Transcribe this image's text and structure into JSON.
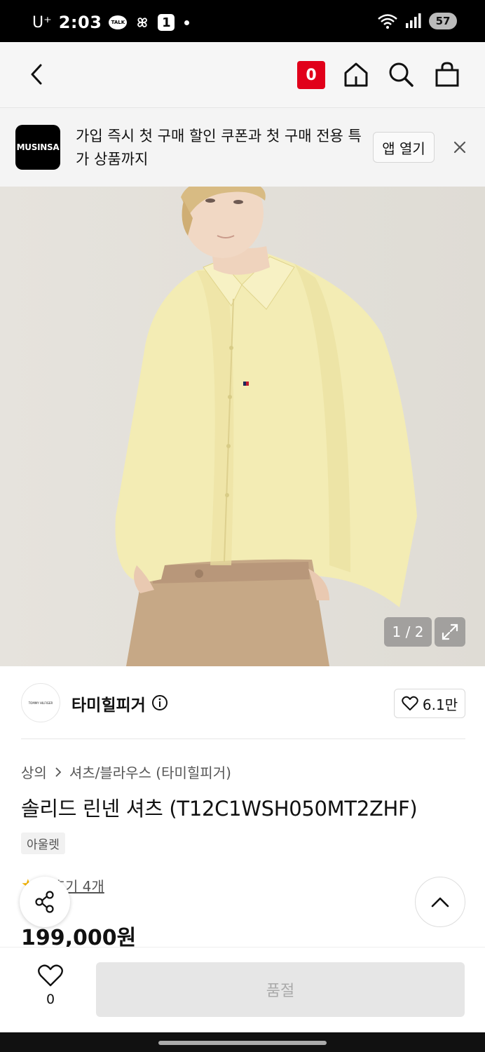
{
  "status": {
    "carrier": "U⁺",
    "time": "2:03",
    "talk_badge": "TALK",
    "notif_count": "1",
    "battery": "57"
  },
  "header": {
    "cart_count": "0",
    "icons": [
      "back-icon",
      "home-icon",
      "search-icon",
      "bag-icon"
    ]
  },
  "banner": {
    "logo": "MUSINSA",
    "text": "가입 즉시 첫 구매 할인 쿠폰과 첫 구매 전용 특가 상품까지",
    "open_app": "앱 열기"
  },
  "gallery": {
    "counter": "1 / 2"
  },
  "brand": {
    "logo_text": "TOMMY HILFIGER",
    "name": "타미힐피거",
    "likes": "6.1만"
  },
  "product": {
    "category": "상의",
    "subcategory": "셔츠/블라우스 (타미힐피거)",
    "title": "솔리드 린넨 셔츠 (T12C1WSH050MT2ZHF)",
    "tag": "아울렛",
    "rating": "5",
    "reviews": "후기 4개",
    "price": "199,000원"
  },
  "bottom": {
    "wish_count": "0",
    "cta": "품절"
  },
  "colors": {
    "accent": "#e1001a",
    "shirt": "#f2eab0",
    "pants": "#c4a684"
  }
}
